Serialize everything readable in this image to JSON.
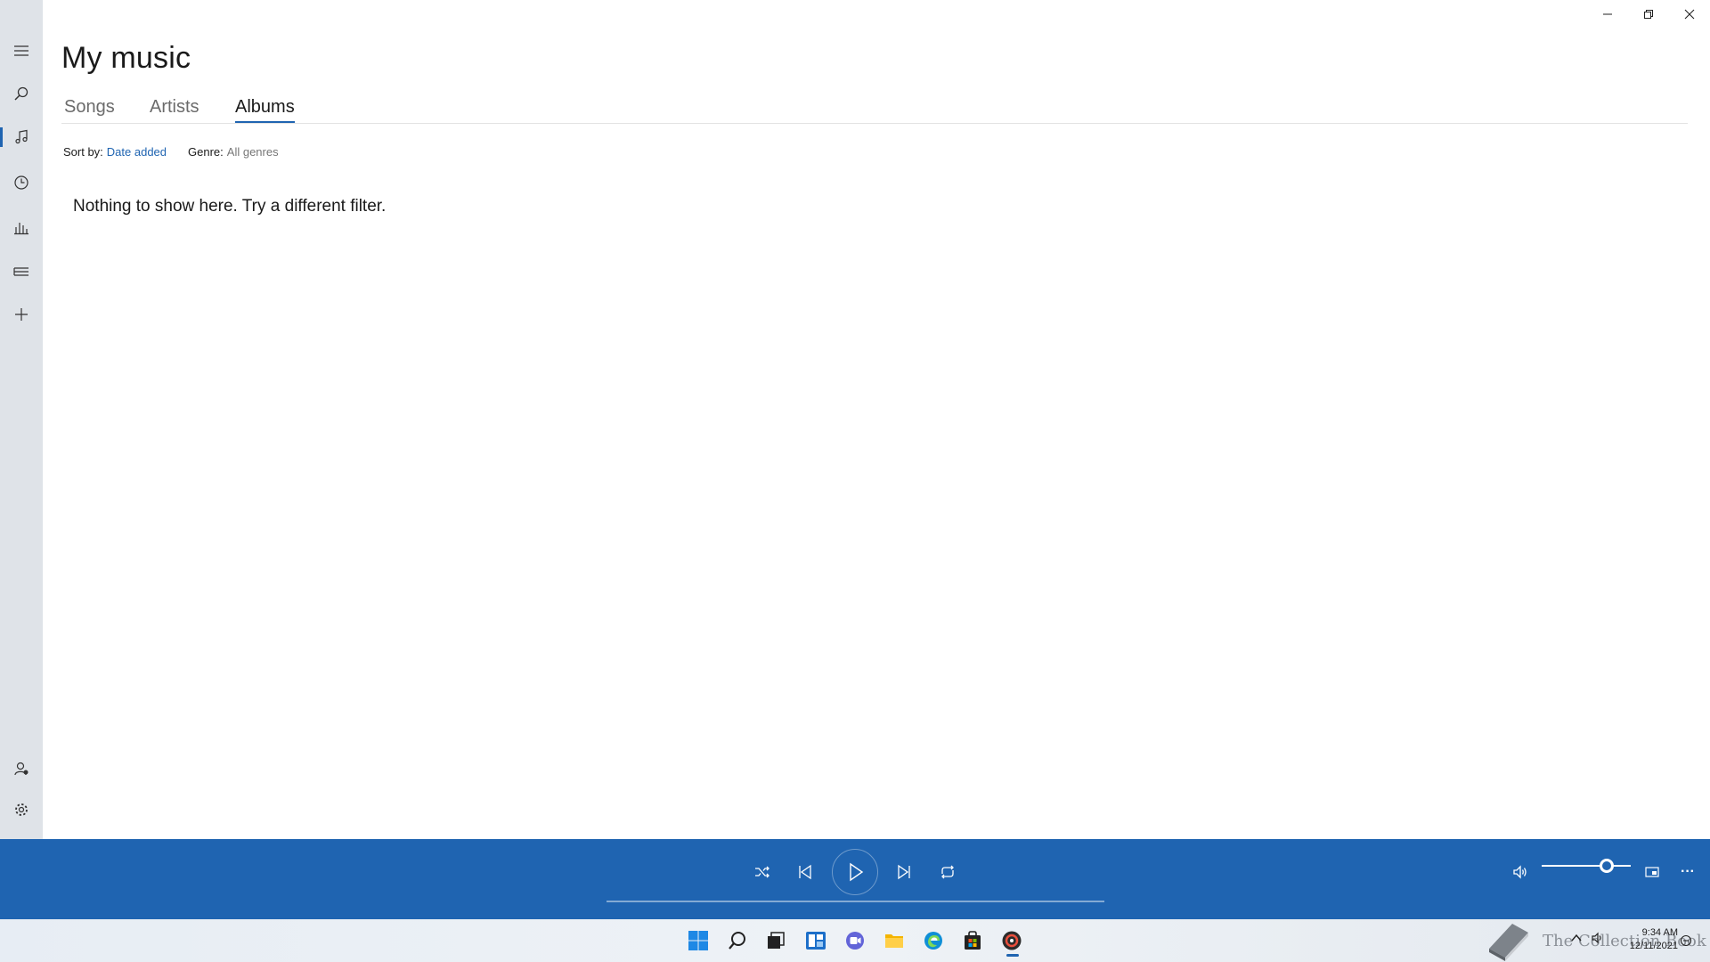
{
  "window": {
    "minimize_icon": "minimize-icon",
    "restore_icon": "restore-icon",
    "close_icon": "close-icon"
  },
  "rail": {
    "items": [
      {
        "name": "menu",
        "icon": "hamburger-icon"
      },
      {
        "name": "search",
        "icon": "search-icon"
      },
      {
        "name": "my-music",
        "icon": "music-note-icon",
        "active": true
      },
      {
        "name": "recent-plays",
        "icon": "clock-icon"
      },
      {
        "name": "now-playing",
        "icon": "equalizer-icon"
      },
      {
        "name": "playlists",
        "icon": "playlist-icon"
      },
      {
        "name": "new-playlist",
        "icon": "plus-icon"
      },
      {
        "name": "account",
        "icon": "account-icon"
      },
      {
        "name": "settings",
        "icon": "gear-icon"
      }
    ]
  },
  "main": {
    "title": "My music",
    "tabs": [
      {
        "label": "Songs",
        "selected": false
      },
      {
        "label": "Artists",
        "selected": false
      },
      {
        "label": "Albums",
        "selected": true
      }
    ],
    "sort_label": "Sort by:",
    "sort_value": "Date added",
    "genre_label": "Genre:",
    "genre_value": "All genres",
    "empty_message": "Nothing to show here. Try a different filter."
  },
  "player": {
    "controls": [
      "shuffle-icon",
      "previous-icon",
      "play-icon",
      "next-icon",
      "repeat-icon"
    ],
    "volume_icon": "volume-icon",
    "volume_level_fraction": 0.76,
    "mini_view_icon": "mini-view-icon",
    "more_label": "···",
    "accent_color": "#1f64b1"
  },
  "taskbar": {
    "apps": [
      "windows-start-icon",
      "search-icon",
      "task-view-icon",
      "widgets-icon",
      "teams-chat-icon",
      "file-explorer-icon",
      "edge-icon",
      "store-icon",
      "groove-music-icon"
    ],
    "watermark_text": "The Collection Book",
    "time": "9:34 AM",
    "date": "12/11/2021"
  }
}
